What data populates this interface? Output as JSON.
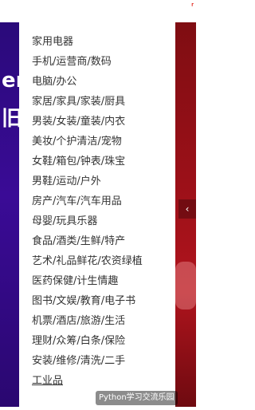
{
  "top_mark": "⸢",
  "left_banner": {
    "glyph1": "er",
    "glyph2": "旧"
  },
  "menu": {
    "items": [
      "家用电器",
      "手机/运营商/数码",
      "电脑/办公",
      "家居/家具/家装/厨具",
      "男装/女装/童装/内衣",
      "美妆/个护清洁/宠物",
      "女鞋/箱包/钟表/珠宝",
      "男鞋/运动/户外",
      "房产/汽车/汽车用品",
      "母婴/玩具乐器",
      "食品/酒类/生鲜/特产",
      "艺术/礼品鲜花/农资绿植",
      "医药保健/计生情趣",
      "图书/文娱/教育/电子书",
      "机票/酒店/旅游/生活",
      "理财/众筹/白条/保险",
      "安装/维修/清洗/二手",
      "工业品"
    ]
  },
  "carousel": {
    "prev_arrow": "‹"
  },
  "watermark": {
    "text": "Python学习交流乐园"
  }
}
